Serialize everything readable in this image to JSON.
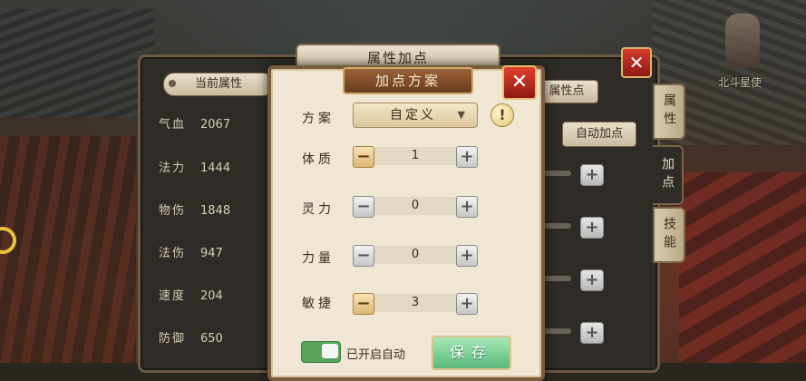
{
  "background": {
    "npc_label": "北斗星使"
  },
  "main_panel": {
    "title": "属性加点",
    "close_glyph": "✕",
    "current_tab": "当前属性",
    "right_tab_partial": "属性点",
    "auto_add": "自动加点",
    "stats": [
      {
        "label": "气血",
        "value": "2067"
      },
      {
        "label": "法力",
        "value": "1444"
      },
      {
        "label": "物伤",
        "value": "1848"
      },
      {
        "label": "法伤",
        "value": "947"
      },
      {
        "label": "速度",
        "value": "204"
      },
      {
        "label": "防御",
        "value": "650"
      }
    ],
    "side_tabs": [
      {
        "label": "属性",
        "active": false
      },
      {
        "label": "加点",
        "active": true
      },
      {
        "label": "技能",
        "active": false
      }
    ]
  },
  "modal": {
    "title": "加点方案",
    "close_glyph": "✕",
    "scheme_label": "方案",
    "scheme_value": "自定义",
    "info_glyph": "!",
    "attributes": [
      {
        "label": "体质",
        "value": "1",
        "minus_active": true
      },
      {
        "label": "灵力",
        "value": "0",
        "minus_active": false
      },
      {
        "label": "力量",
        "value": "0",
        "minus_active": false
      },
      {
        "label": "敏捷",
        "value": "3",
        "minus_active": true
      }
    ],
    "minus_glyph": "−",
    "plus_glyph": "+",
    "auto_toggle_on": true,
    "auto_label": "已开启自动",
    "save_label": "保存"
  },
  "colors": {
    "modal_bg": "#efe6d4",
    "save_green": "#58b87a",
    "close_red": "#d63b2b"
  }
}
